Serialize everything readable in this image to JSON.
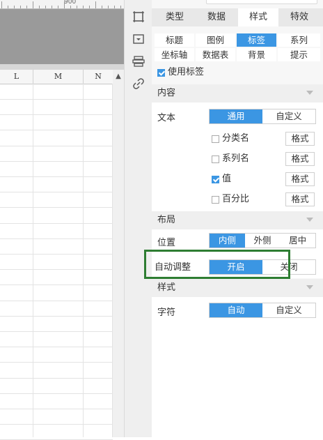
{
  "ruler": {
    "mark": "900"
  },
  "sheet": {
    "columns": [
      "L",
      "M",
      "N"
    ],
    "scroll_up_icon": "▲"
  },
  "tools": [
    "chart-type-icon",
    "component-icon",
    "layer-icon",
    "link-icon"
  ],
  "panel": {
    "tabs": [
      {
        "label": "类型",
        "active": false
      },
      {
        "label": "数据",
        "active": false
      },
      {
        "label": "样式",
        "active": true
      },
      {
        "label": "特效",
        "active": false
      }
    ],
    "subtabs": [
      {
        "label": "标题",
        "active": false
      },
      {
        "label": "图例",
        "active": false
      },
      {
        "label": "标签",
        "active": true
      },
      {
        "label": "系列",
        "active": false
      },
      {
        "label": "坐标轴",
        "active": false
      },
      {
        "label": "数据表",
        "active": false
      },
      {
        "label": "背景",
        "active": false
      },
      {
        "label": "提示",
        "active": false
      }
    ],
    "use_label": {
      "text": "使用标签",
      "checked": true
    },
    "content": {
      "header": "内容",
      "text_label": "文本",
      "text_options": [
        "通用",
        "自定义"
      ],
      "text_selected": 0,
      "checks": [
        {
          "label": "分类名",
          "checked": false,
          "button": "格式"
        },
        {
          "label": "系列名",
          "checked": false,
          "button": "格式"
        },
        {
          "label": "值",
          "checked": true,
          "button": "格式"
        },
        {
          "label": "百分比",
          "checked": false,
          "button": "格式"
        }
      ]
    },
    "layout": {
      "header": "布局",
      "position_label": "位置",
      "position_options": [
        "内侧",
        "外侧",
        "居中"
      ],
      "position_selected": 0,
      "auto_label": "自动调整",
      "auto_options": [
        "开启",
        "关闭"
      ],
      "auto_selected": 0
    },
    "style": {
      "header": "样式",
      "char_label": "字符",
      "char_options": [
        "自动",
        "自定义"
      ],
      "char_selected": 0
    }
  },
  "colors": {
    "accent": "#3b96e3",
    "highlight": "#2e7d32"
  }
}
